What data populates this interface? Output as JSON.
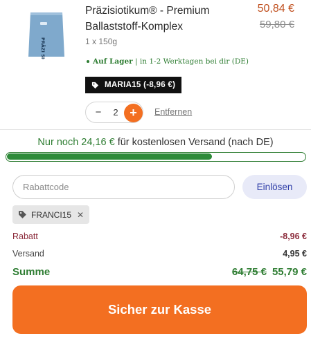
{
  "cart_item": {
    "name": "Präzisiotikum® - Premium Ballaststoff-Komplex",
    "package_text": "PRÄZI SIOTIKUM",
    "price_current": "50,84 €",
    "price_original": "59,80 €",
    "variant": "1 x 150g",
    "stock_status_bold": "Auf Lager",
    "stock_status_rest": " | in 1-2 Werktagen bei dir (DE)",
    "coupon_tag": "MARIA15 (-8,96 €)",
    "quantity": "2",
    "minus_label": "−",
    "plus_label": "+",
    "remove_label": "Entfernen"
  },
  "shipping": {
    "prefix": "Nur noch 24,16 €",
    "suffix": " für kostenlosen Versand (nach DE)",
    "progress_fraction": 0.69,
    "accent_color": "#2e7d32"
  },
  "discount": {
    "placeholder": "Rabattcode",
    "redeem_label": "Einlösen",
    "applied_code": "FRANCI15",
    "remove_symbol": "✕"
  },
  "summary": {
    "rabatt_label": "Rabatt",
    "rabatt_value": "-8,96 €",
    "versand_label": "Versand",
    "versand_value": "4,95 €",
    "summe_label": "Summe",
    "summe_old": "64,75 €",
    "summe_new": "55,79 €"
  },
  "checkout": {
    "label": "Sicher zur Kasse",
    "color": "#f36f21"
  },
  "icons": {
    "tag": "tag-icon",
    "close": "close-icon"
  }
}
